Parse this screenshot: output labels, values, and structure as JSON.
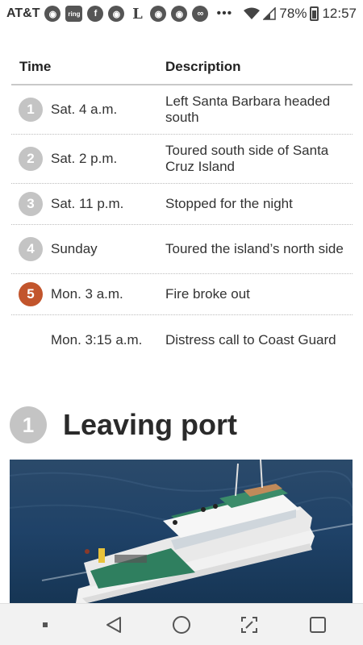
{
  "status_bar": {
    "carrier": "AT&T",
    "notification_icons": [
      "chrome-icon",
      "ring-icon",
      "facebook-icon",
      "chrome-icon",
      "la-times-icon",
      "chrome-icon",
      "chrome-icon",
      "tripadvisor-icon"
    ],
    "ring_label": "ring",
    "facebook_label": "f",
    "latimes_label": "L",
    "more": "•••",
    "battery": "78%",
    "time": "12:57"
  },
  "timeline": {
    "headers": {
      "time": "Time",
      "description": "Description"
    },
    "rows": [
      {
        "num": "1",
        "time": "Sat. 4 a.m.",
        "desc": "Left Santa Barbara headed south",
        "highlight": false
      },
      {
        "num": "2",
        "time": "Sat. 2 p.m.",
        "desc": "Toured south side of Santa Cruz Island",
        "highlight": false
      },
      {
        "num": "3",
        "time": "Sat. 11 p.m.",
        "desc": "Stopped for the night",
        "highlight": false
      },
      {
        "num": "4",
        "time": "Sunday",
        "desc": "Toured the island’s north side",
        "highlight": false
      },
      {
        "num": "5",
        "time": "Mon. 3 a.m.",
        "desc": "Fire broke out",
        "highlight": true
      },
      {
        "num": "",
        "time": "Mon. 3:15 a.m.",
        "desc": "Distress call to Coast Guard",
        "highlight": false
      }
    ]
  },
  "section": {
    "num": "1",
    "title": "Leaving port"
  },
  "colors": {
    "accent": "#c2552c",
    "marker": "#c4c4c4",
    "text": "#2b2b2b"
  },
  "nav": {
    "buttons": [
      "dot-icon",
      "back-icon",
      "home-icon",
      "screenshot-icon",
      "recents-icon"
    ]
  }
}
